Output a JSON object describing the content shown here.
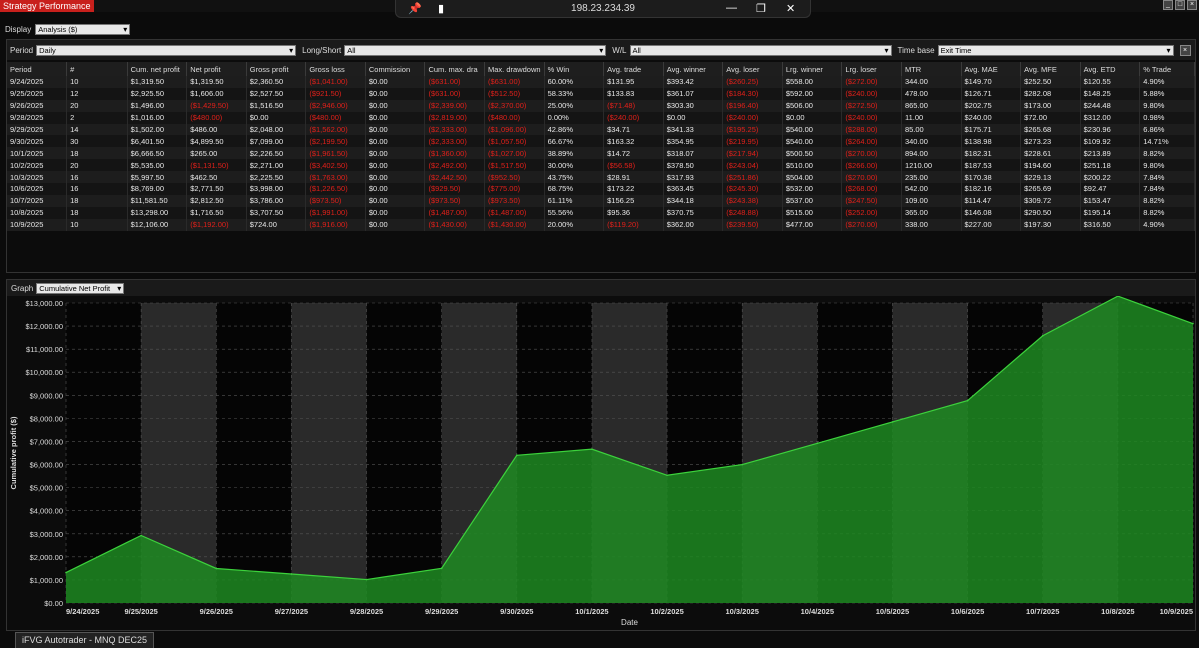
{
  "window": {
    "title": "Strategy Performance",
    "remote_ip": "198.23.234.39",
    "status_tab": "iFVG Autotrader - MNQ DEC25"
  },
  "toolbar": {
    "display_label": "Display",
    "display_value": "Analysis ($)"
  },
  "filters": {
    "period_label": "Period",
    "period_value": "Daily",
    "ls_label": "Long/Short",
    "ls_value": "All",
    "wl_label": "W/L",
    "wl_value": "All",
    "tb_label": "Time base",
    "tb_value": "Exit Time"
  },
  "table": {
    "columns": [
      "Period",
      "#",
      "Cum. net profit",
      "Net profit",
      "Gross profit",
      "Gross loss",
      "Commission",
      "Cum. max. drawdown",
      "Max. drawdown",
      "% Win",
      "Avg. trade",
      "Avg. winner",
      "Avg. loser",
      "Lrg. winner",
      "Lrg. loser",
      "MTR",
      "Avg. MAE",
      "Avg. MFE",
      "Avg. ETD",
      "% Trade"
    ],
    "column_headers_display": [
      "Period",
      "#",
      "Cum. net profit",
      "Net profit",
      "Gross profit",
      "Gross loss",
      "Commission",
      "Cum. max. dra",
      "Max. drawdown",
      "% Win",
      "Avg. trade",
      "Avg. winner",
      "Avg. loser",
      "Lrg. winner",
      "Lrg. loser",
      "MTR",
      "Avg. MAE",
      "Avg. MFE",
      "Avg. ETD",
      "% Trade"
    ],
    "rows": [
      [
        "9/24/2025",
        "10",
        "$1,319.50",
        "$1,319.50",
        "$2,360.50",
        "($1,041.00)",
        "$0.00",
        "($631.00)",
        "($631.00)",
        "60.00%",
        "$131.95",
        "$393.42",
        "($260.25)",
        "$558.00",
        "($272.00)",
        "344.00",
        "$149.70",
        "$252.50",
        "$120.55",
        "4.90%"
      ],
      [
        "9/25/2025",
        "12",
        "$2,925.50",
        "$1,606.00",
        "$2,527.50",
        "($921.50)",
        "$0.00",
        "($631.00)",
        "($512.50)",
        "58.33%",
        "$133.83",
        "$361.07",
        "($184.30)",
        "$592.00",
        "($240.00)",
        "478.00",
        "$126.71",
        "$282.08",
        "$148.25",
        "5.88%"
      ],
      [
        "9/26/2025",
        "20",
        "$1,496.00",
        "($1,429.50)",
        "$1,516.50",
        "($2,946.00)",
        "$0.00",
        "($2,339.00)",
        "($2,370.00)",
        "25.00%",
        "($71.48)",
        "$303.30",
        "($196.40)",
        "$506.00",
        "($272.50)",
        "865.00",
        "$202.75",
        "$173.00",
        "$244.48",
        "9.80%"
      ],
      [
        "9/28/2025",
        "2",
        "$1,016.00",
        "($480.00)",
        "$0.00",
        "($480.00)",
        "$0.00",
        "($2,819.00)",
        "($480.00)",
        "0.00%",
        "($240.00)",
        "$0.00",
        "($240.00)",
        "$0.00",
        "($240.00)",
        "11.00",
        "$240.00",
        "$72.00",
        "$312.00",
        "0.98%"
      ],
      [
        "9/29/2025",
        "14",
        "$1,502.00",
        "$486.00",
        "$2,048.00",
        "($1,562.00)",
        "$0.00",
        "($2,333.00)",
        "($1,096.00)",
        "42.86%",
        "$34.71",
        "$341.33",
        "($195.25)",
        "$540.00",
        "($288.00)",
        "85.00",
        "$175.71",
        "$265.68",
        "$230.96",
        "6.86%"
      ],
      [
        "9/30/2025",
        "30",
        "$6,401.50",
        "$4,899.50",
        "$7,099.00",
        "($2,199.50)",
        "$0.00",
        "($2,333.00)",
        "($1,057.50)",
        "66.67%",
        "$163.32",
        "$354.95",
        "($219.95)",
        "$540.00",
        "($264.00)",
        "340.00",
        "$138.98",
        "$273.23",
        "$109.92",
        "14.71%"
      ],
      [
        "10/1/2025",
        "18",
        "$6,666.50",
        "$265.00",
        "$2,226.50",
        "($1,961.50)",
        "$0.00",
        "($1,360.00)",
        "($1,027.00)",
        "38.89%",
        "$14.72",
        "$318.07",
        "($217.94)",
        "$500.50",
        "($270.00)",
        "894.00",
        "$182.31",
        "$228.61",
        "$213.89",
        "8.82%"
      ],
      [
        "10/2/2025",
        "20",
        "$5,535.00",
        "($1,131.50)",
        "$2,271.00",
        "($3,402.50)",
        "$0.00",
        "($2,492.00)",
        "($1,517.50)",
        "30.00%",
        "($56.58)",
        "$378.50",
        "($243.04)",
        "$510.00",
        "($266.00)",
        "1210.00",
        "$187.53",
        "$194.60",
        "$251.18",
        "9.80%"
      ],
      [
        "10/3/2025",
        "16",
        "$5,997.50",
        "$462.50",
        "$2,225.50",
        "($1,763.00)",
        "$0.00",
        "($2,442.50)",
        "($952.50)",
        "43.75%",
        "$28.91",
        "$317.93",
        "($251.86)",
        "$504.00",
        "($270.00)",
        "235.00",
        "$170.38",
        "$229.13",
        "$200.22",
        "7.84%"
      ],
      [
        "10/6/2025",
        "16",
        "$8,769.00",
        "$2,771.50",
        "$3,998.00",
        "($1,226.50)",
        "$0.00",
        "($929.50)",
        "($775.00)",
        "68.75%",
        "$173.22",
        "$363.45",
        "($245.30)",
        "$532.00",
        "($268.00)",
        "542.00",
        "$182.16",
        "$265.69",
        "$92.47",
        "7.84%"
      ],
      [
        "10/7/2025",
        "18",
        "$11,581.50",
        "$2,812.50",
        "$3,786.00",
        "($973.50)",
        "$0.00",
        "($973.50)",
        "($973.50)",
        "61.11%",
        "$156.25",
        "$344.18",
        "($243.38)",
        "$537.00",
        "($247.50)",
        "109.00",
        "$114.47",
        "$309.72",
        "$153.47",
        "8.82%"
      ],
      [
        "10/8/2025",
        "18",
        "$13,298.00",
        "$1,716.50",
        "$3,707.50",
        "($1,991.00)",
        "$0.00",
        "($1,487.00)",
        "($1,487.00)",
        "55.56%",
        "$95.36",
        "$370.75",
        "($248.88)",
        "$515.00",
        "($252.00)",
        "365.00",
        "$146.08",
        "$290.50",
        "$195.14",
        "8.82%"
      ],
      [
        "10/9/2025",
        "10",
        "$12,106.00",
        "($1,192.00)",
        "$724.00",
        "($1,916.00)",
        "$0.00",
        "($1,430.00)",
        "($1,430.00)",
        "20.00%",
        "($119.20)",
        "$362.00",
        "($239.50)",
        "$477.00",
        "($270.00)",
        "338.00",
        "$227.00",
        "$197.30",
        "$316.50",
        "4.90%"
      ]
    ]
  },
  "graph": {
    "label": "Graph",
    "selector": "Cumulative Net Profit"
  },
  "chart_data": {
    "type": "area",
    "ylabel": "Cumulative profit ($)",
    "xlabel": "Date",
    "x": [
      "9/24/2025",
      "9/25/2025",
      "9/26/2025",
      "9/27/2025",
      "9/28/2025",
      "9/29/2025",
      "9/30/2025",
      "10/1/2025",
      "10/2/2025",
      "10/3/2025",
      "10/4/2025",
      "10/5/2025",
      "10/6/2025",
      "10/7/2025",
      "10/8/2025",
      "10/9/2025"
    ],
    "series": [
      {
        "values": [
          1319.5,
          2925.5,
          1496.0,
          1256.0,
          1016.0,
          1502.0,
          6401.5,
          6666.5,
          5535.0,
          5997.5,
          6921.4,
          7845.3,
          8769.0,
          11581.5,
          13298.0,
          12106.0
        ]
      }
    ],
    "ylim": [
      0,
      13000
    ],
    "yticks": [
      "$0.00",
      "$1,000.00",
      "$2,000.00",
      "$3,000.00",
      "$4,000.00",
      "$5,000.00",
      "$6,000.00",
      "$7,000.00",
      "$8,000.00",
      "$9,000.00",
      "$10,000.00",
      "$11,000.00",
      "$12,000.00",
      "$13,000.00"
    ],
    "grid": true,
    "colors": {
      "fill": "#1e8a22",
      "line": "#3cd23c",
      "bg_light": "#2a2a2a",
      "bg_dark": "#050505"
    }
  }
}
